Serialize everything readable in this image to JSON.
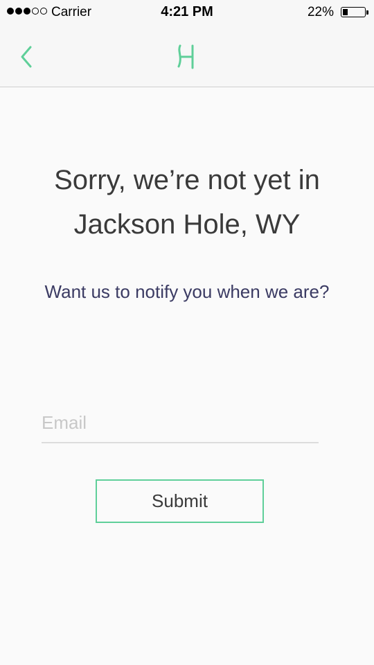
{
  "status_bar": {
    "carrier": "Carrier",
    "time": "4:21 PM",
    "battery_percent": "22%",
    "battery_level": 0.22,
    "signal_bars_filled": 3,
    "signal_bars_total": 5
  },
  "nav": {
    "back_icon": "chevron-left-icon",
    "logo_icon": "brand-logo-icon",
    "accent_color": "#5fcf99"
  },
  "main": {
    "headline_line1": "Sorry, we’re not yet in",
    "headline_line2": "Jackson Hole, WY",
    "subhead": "Want us to notify you when we are?",
    "email_placeholder": "Email",
    "email_value": "",
    "submit_label": "Submit"
  },
  "colors": {
    "background": "#fafafa",
    "headline_text": "#3a3a3a",
    "subhead_text": "#3b3b63",
    "accent": "#5fcf99"
  }
}
